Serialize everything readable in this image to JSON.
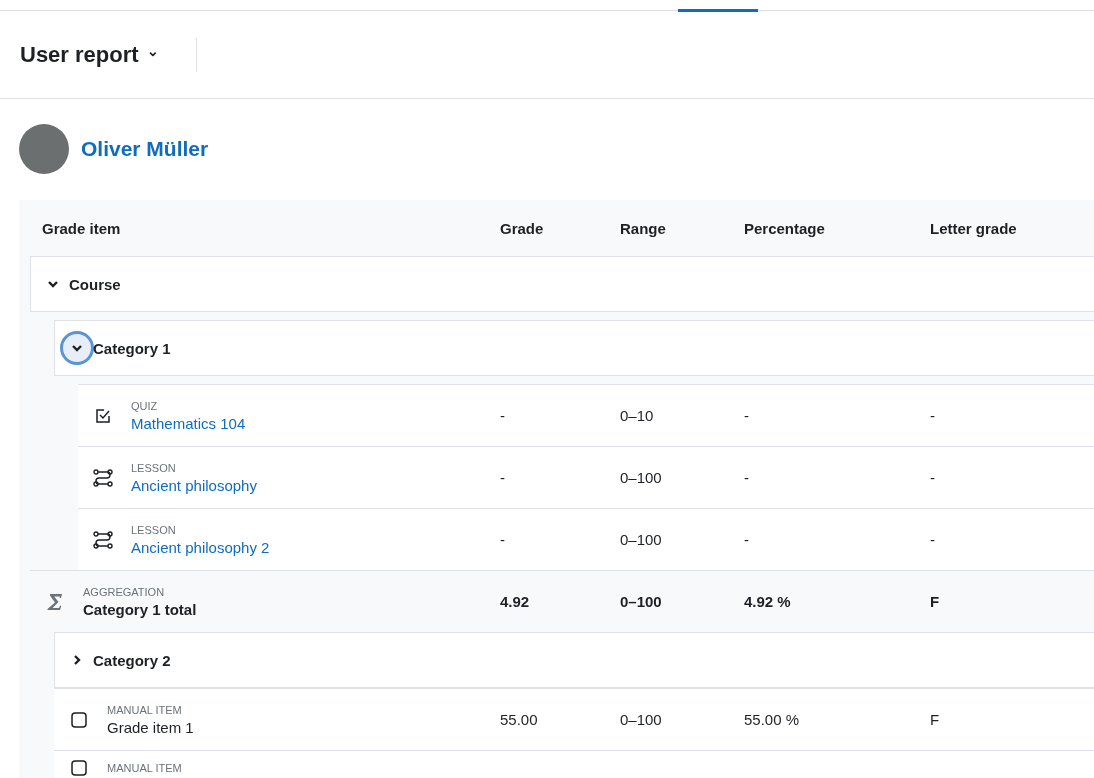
{
  "report_selector": {
    "title": "User report",
    "caret": "⌄"
  },
  "user": {
    "name": "Oliver Müller"
  },
  "table": {
    "columns": [
      "Grade item",
      "Grade",
      "Range",
      "Percentage",
      "Letter grade"
    ],
    "rows": [
      {
        "kind": "category",
        "name": "Course",
        "expanded": true,
        "focused": false,
        "children": [
          {
            "kind": "category",
            "name": "Category 1",
            "expanded": true,
            "focused": true,
            "children": [
              {
                "kind": "quiz",
                "type_label": "QUIZ",
                "name": "Mathematics 104",
                "cells": [
                  "-",
                  "0–10",
                  "-",
                  "-"
                ]
              },
              {
                "kind": "lesson",
                "type_label": "LESSON",
                "name": "Ancient philosophy",
                "cells": [
                  "-",
                  "0–100",
                  "-",
                  "-"
                ]
              },
              {
                "kind": "lesson",
                "type_label": "LESSON",
                "name": "Ancient philosophy 2",
                "cells": [
                  "-",
                  "0–100",
                  "-",
                  "-"
                ]
              }
            ]
          },
          {
            "kind": "aggregation",
            "type_label": "AGGREGATION",
            "name": "Category 1 total",
            "cells": [
              "4.92",
              "0–100",
              "4.92 %",
              "F"
            ]
          },
          {
            "kind": "category",
            "name": "Category 2",
            "expanded": false,
            "focused": false
          },
          {
            "kind": "manual",
            "type_label": "MANUAL ITEM",
            "name": "Grade item 1",
            "cells": [
              "55.00",
              "0–100",
              "55.00 %",
              "F"
            ]
          },
          {
            "kind": "manual",
            "type_label": "MANUAL ITEM"
          }
        ]
      }
    ]
  }
}
